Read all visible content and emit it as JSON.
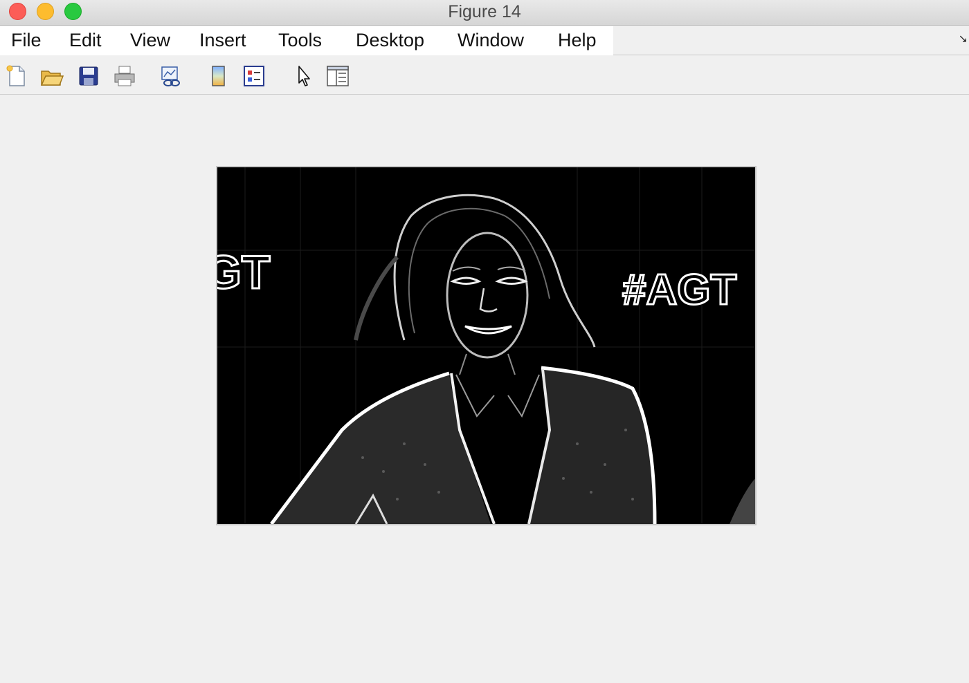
{
  "window": {
    "title": "Figure 14"
  },
  "menu": {
    "items": [
      "File",
      "Edit",
      "View",
      "Insert",
      "Tools",
      "Desktop",
      "Window",
      "Help"
    ]
  },
  "toolbar": {
    "icons": [
      "new-figure-icon",
      "open-file-icon",
      "save-icon",
      "print-icon",
      "link-plot-icon",
      "insert-colorbar-icon",
      "insert-legend-icon",
      "edit-plot-pointer-icon",
      "property-inspector-icon"
    ]
  },
  "figure": {
    "overlay_text_left": "GT",
    "overlay_text_right": "#AGT"
  },
  "colors": {
    "close": "#fc5d57",
    "minimize": "#fdbc2e",
    "maximize": "#29c940",
    "image_background": "#000000",
    "edge_white": "#ffffff"
  }
}
